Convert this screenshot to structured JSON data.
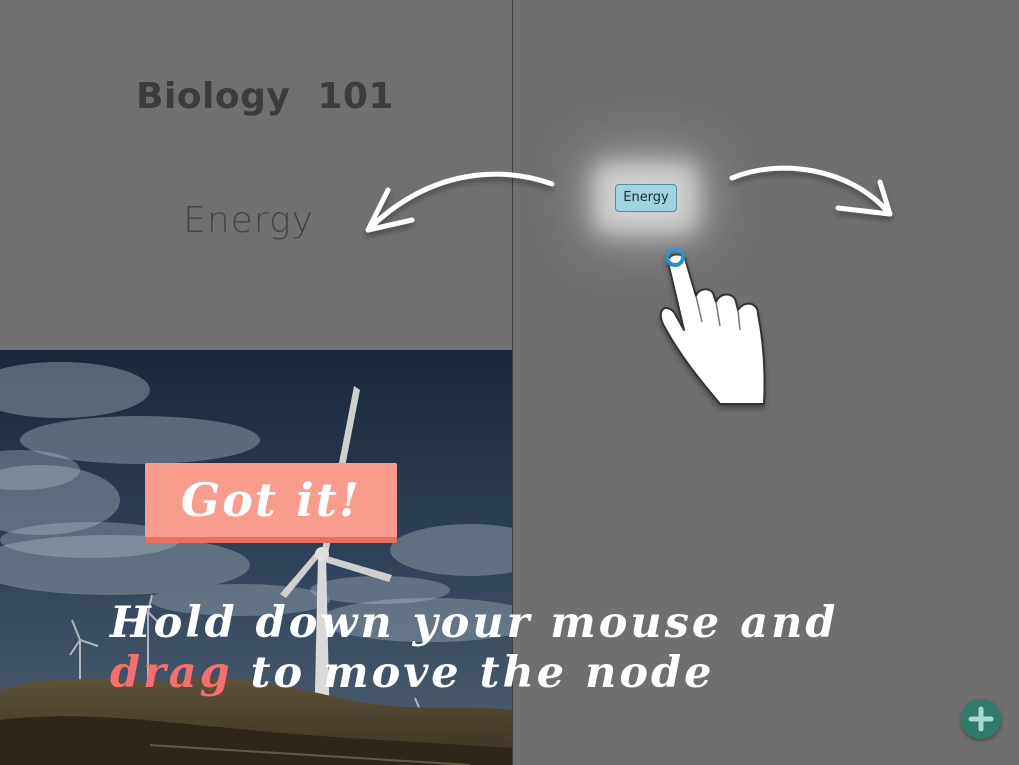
{
  "course": {
    "title": "Biology  101"
  },
  "topic": {
    "title": "Energy"
  },
  "canvas": {
    "node_label": "Energy"
  },
  "tutorial": {
    "button_label": "Got it!",
    "hint_line1": "Hold down your mouse and",
    "hint_highlight": "drag",
    "hint_rest": " to move the node"
  },
  "icons": {
    "add": "plus-icon",
    "hand": "pointing-hand-icon",
    "arrow_left": "curved-arrow-left-icon",
    "arrow_right": "curved-arrow-right-icon"
  },
  "colors": {
    "button_bg": "#f89d8e",
    "highlight_text": "#f56f6f",
    "node_bg": "#9fd3df",
    "add_button": "#2f7a6b"
  }
}
